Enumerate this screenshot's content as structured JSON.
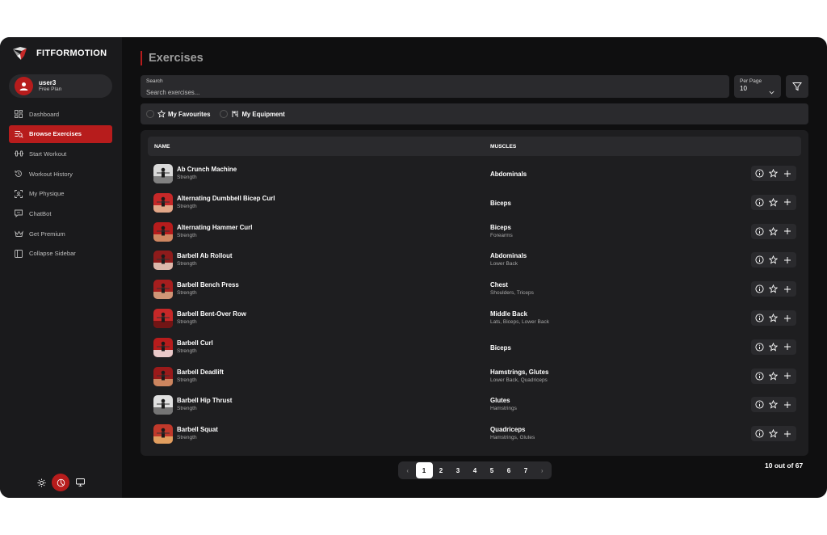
{
  "app": {
    "brand": "FITFORMOTION",
    "accent": "#b71c1c"
  },
  "user": {
    "name": "user3",
    "plan": "Free Plan"
  },
  "sidebar": {
    "items": [
      {
        "label": "Dashboard",
        "icon": "dashboard-icon",
        "active": false
      },
      {
        "label": "Browse Exercises",
        "icon": "browse-icon",
        "active": true
      },
      {
        "label": "Start Workout",
        "icon": "dumbbell-icon",
        "active": false
      },
      {
        "label": "Workout History",
        "icon": "history-icon",
        "active": false
      },
      {
        "label": "My Physique",
        "icon": "physique-icon",
        "active": false
      },
      {
        "label": "ChatBot",
        "icon": "chat-icon",
        "active": false
      },
      {
        "label": "Get Premium",
        "icon": "crown-icon",
        "active": false
      },
      {
        "label": "Collapse Sidebar",
        "icon": "sidebar-icon",
        "active": false
      }
    ],
    "theme_modes": [
      "sun-icon",
      "moon-icon",
      "monitor-icon"
    ],
    "theme_active": "moon-icon"
  },
  "page": {
    "title": "Exercises",
    "search_label": "Search",
    "search_placeholder": "Search exercises...",
    "search_value": "",
    "per_page_label": "Per Page",
    "per_page_value": "10",
    "filters": [
      "My Favourites",
      "My Equipment"
    ]
  },
  "table": {
    "columns": [
      "NAME",
      "MUSCLES"
    ],
    "rows": [
      {
        "name": "Ab Crunch Machine",
        "type": "Strength",
        "primary": "Abdominals",
        "secondary": ""
      },
      {
        "name": "Alternating Dumbbell Bicep Curl",
        "type": "Strength",
        "primary": "Biceps",
        "secondary": ""
      },
      {
        "name": "Alternating Hammer Curl",
        "type": "Strength",
        "primary": "Biceps",
        "secondary": "Forearms"
      },
      {
        "name": "Barbell Ab Rollout",
        "type": "Strength",
        "primary": "Abdominals",
        "secondary": "Lower Back"
      },
      {
        "name": "Barbell Bench Press",
        "type": "Strength",
        "primary": "Chest",
        "secondary": "Shoulders, Triceps"
      },
      {
        "name": "Barbell Bent-Over Row",
        "type": "Strength",
        "primary": "Middle Back",
        "secondary": "Lats, Biceps, Lower Back"
      },
      {
        "name": "Barbell Curl",
        "type": "Strength",
        "primary": "Biceps",
        "secondary": ""
      },
      {
        "name": "Barbell Deadlift",
        "type": "Strength",
        "primary": "Hamstrings, Glutes",
        "secondary": "Lower Back, Quadriceps"
      },
      {
        "name": "Barbell Hip Thrust",
        "type": "Strength",
        "primary": "Glutes",
        "secondary": "Hamstrings"
      },
      {
        "name": "Barbell Squat",
        "type": "Strength",
        "primary": "Quadriceps",
        "secondary": "Hamstrings, Glutes"
      }
    ]
  },
  "pagination": {
    "prev": "‹",
    "next": "›",
    "pages": [
      "1",
      "2",
      "3",
      "4",
      "5",
      "6",
      "7"
    ],
    "current": "1",
    "summary": "10 out of 67"
  }
}
